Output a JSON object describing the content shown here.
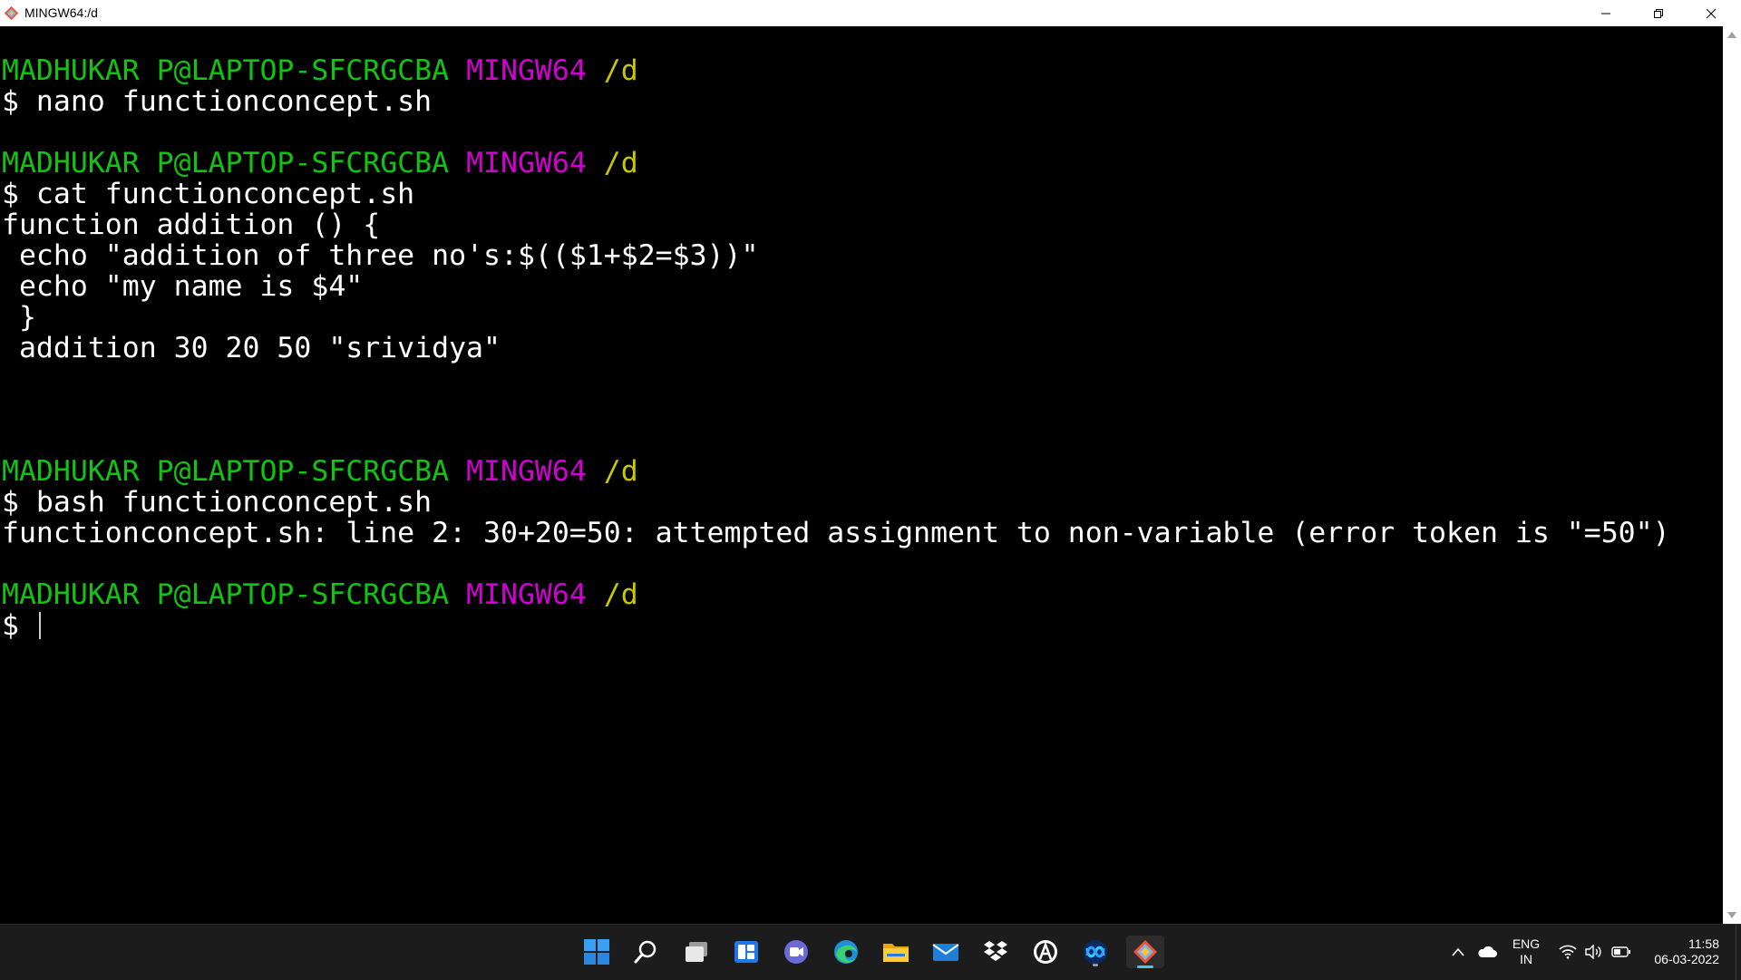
{
  "window": {
    "title": "MINGW64:/d",
    "icon": "git-bash-icon",
    "controls": [
      "minimize",
      "restore",
      "close"
    ]
  },
  "terminal": {
    "colors": {
      "user": "#12c312",
      "host": "#d000d0",
      "path": "#c8c800",
      "text": "#ffffff",
      "background": "#000000"
    },
    "lines": [
      {
        "kind": "prompt",
        "user": "MADHUKAR P@LAPTOP-SFCRGCBA",
        "host": "MINGW64",
        "path": "/d"
      },
      {
        "kind": "text",
        "text": "$ nano functionconcept.sh"
      },
      {
        "kind": "blank",
        "text": ""
      },
      {
        "kind": "prompt",
        "user": "MADHUKAR P@LAPTOP-SFCRGCBA",
        "host": "MINGW64",
        "path": "/d"
      },
      {
        "kind": "text",
        "text": "$ cat functionconcept.sh"
      },
      {
        "kind": "text",
        "text": "function addition () {"
      },
      {
        "kind": "text",
        "text": " echo \"addition of three no's:$(($1+$2=$3))\""
      },
      {
        "kind": "text",
        "text": " echo \"my name is $4\""
      },
      {
        "kind": "text",
        "text": " }"
      },
      {
        "kind": "text",
        "text": " addition 30 20 50 \"srividya\""
      },
      {
        "kind": "blank",
        "text": ""
      },
      {
        "kind": "blank",
        "text": ""
      },
      {
        "kind": "blank",
        "text": ""
      },
      {
        "kind": "prompt",
        "user": "MADHUKAR P@LAPTOP-SFCRGCBA",
        "host": "MINGW64",
        "path": "/d"
      },
      {
        "kind": "text",
        "text": "$ bash functionconcept.sh"
      },
      {
        "kind": "text",
        "text": "functionconcept.sh: line 2: 30+20=50: attempted assignment to non-variable (error token is \"=50\")"
      },
      {
        "kind": "blank",
        "text": ""
      },
      {
        "kind": "prompt",
        "user": "MADHUKAR P@LAPTOP-SFCRGCBA",
        "host": "MINGW64",
        "path": "/d"
      },
      {
        "kind": "input",
        "text": "$ "
      }
    ]
  },
  "taskbar": {
    "apps": [
      {
        "name": "start-button",
        "icon": "windows-logo-icon"
      },
      {
        "name": "search-button",
        "icon": "search-icon"
      },
      {
        "name": "task-view-button",
        "icon": "task-view-icon"
      },
      {
        "name": "widgets-button",
        "icon": "widgets-icon"
      },
      {
        "name": "teams-chat-button",
        "icon": "chat-icon"
      },
      {
        "name": "edge-button",
        "icon": "edge-icon"
      },
      {
        "name": "file-explorer-button",
        "icon": "folder-icon"
      },
      {
        "name": "mail-button",
        "icon": "mail-icon"
      },
      {
        "name": "dropbox-button",
        "icon": "dropbox-icon"
      },
      {
        "name": "app-a-button",
        "icon": "a-logo-icon"
      },
      {
        "name": "webex-button",
        "icon": "webex-icon",
        "running": true
      },
      {
        "name": "git-bash-button",
        "icon": "git-bash-icon",
        "active": true
      }
    ],
    "tray": {
      "language": "ENG",
      "region": "IN",
      "time": "11:58",
      "date": "06-03-2022"
    }
  }
}
